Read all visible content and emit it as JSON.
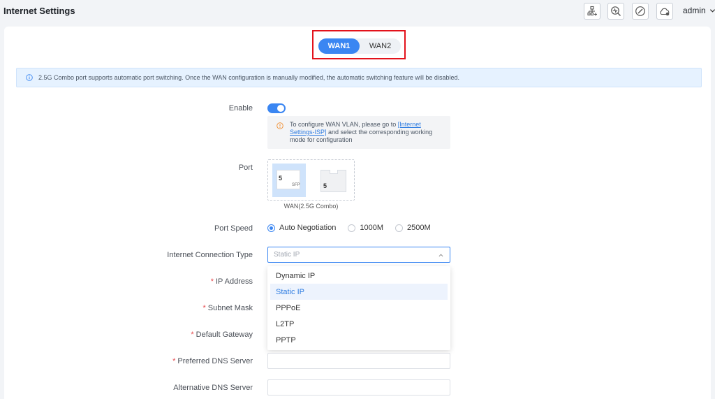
{
  "header": {
    "title": "Internet Settings",
    "user": "admin",
    "icons": [
      "network-topology-icon",
      "diagnose-icon",
      "compass-icon",
      "cloud-icon"
    ]
  },
  "wan_tabs": [
    {
      "label": "WAN1",
      "active": true
    },
    {
      "label": "WAN2",
      "active": false
    }
  ],
  "banner": {
    "text": "2.5G Combo port supports automatic port switching. Once the WAN configuration is manually modified, the automatic switching feature will be disabled."
  },
  "form": {
    "enable": {
      "label": "Enable",
      "value": true
    },
    "tip": {
      "before": "To configure WAN VLAN, please go to ",
      "link": "[Internet Settings-ISP]",
      "after": " and select the corresponding working mode for configuration"
    },
    "port": {
      "label": "Port",
      "sfp_number": "5",
      "sfp_tag": "SFP",
      "rj_number": "5",
      "caption": "WAN(2.5G Combo)"
    },
    "port_speed": {
      "label": "Port Speed",
      "options": [
        "Auto Negotiation",
        "1000M",
        "2500M"
      ],
      "selected": "Auto Negotiation"
    },
    "connection_type": {
      "label": "Internet Connection Type",
      "value": "Static IP",
      "options": [
        "Dynamic IP",
        "Static IP",
        "PPPoE",
        "L2TP",
        "PPTP"
      ]
    },
    "ip_address": {
      "label": "IP Address",
      "required_mark": "*"
    },
    "subnet_mask": {
      "label": "Subnet Mask",
      "required_mark": "*"
    },
    "default_gateway": {
      "label": "Default Gateway",
      "required_mark": "*"
    },
    "preferred_dns": {
      "label": "Preferred DNS Server",
      "required_mark": "*"
    },
    "alternative_dns": {
      "label": "Alternative DNS Server"
    }
  },
  "colors": {
    "accent": "#3a86f2",
    "highlight_border": "#e3121b",
    "required": "#e5484d"
  }
}
